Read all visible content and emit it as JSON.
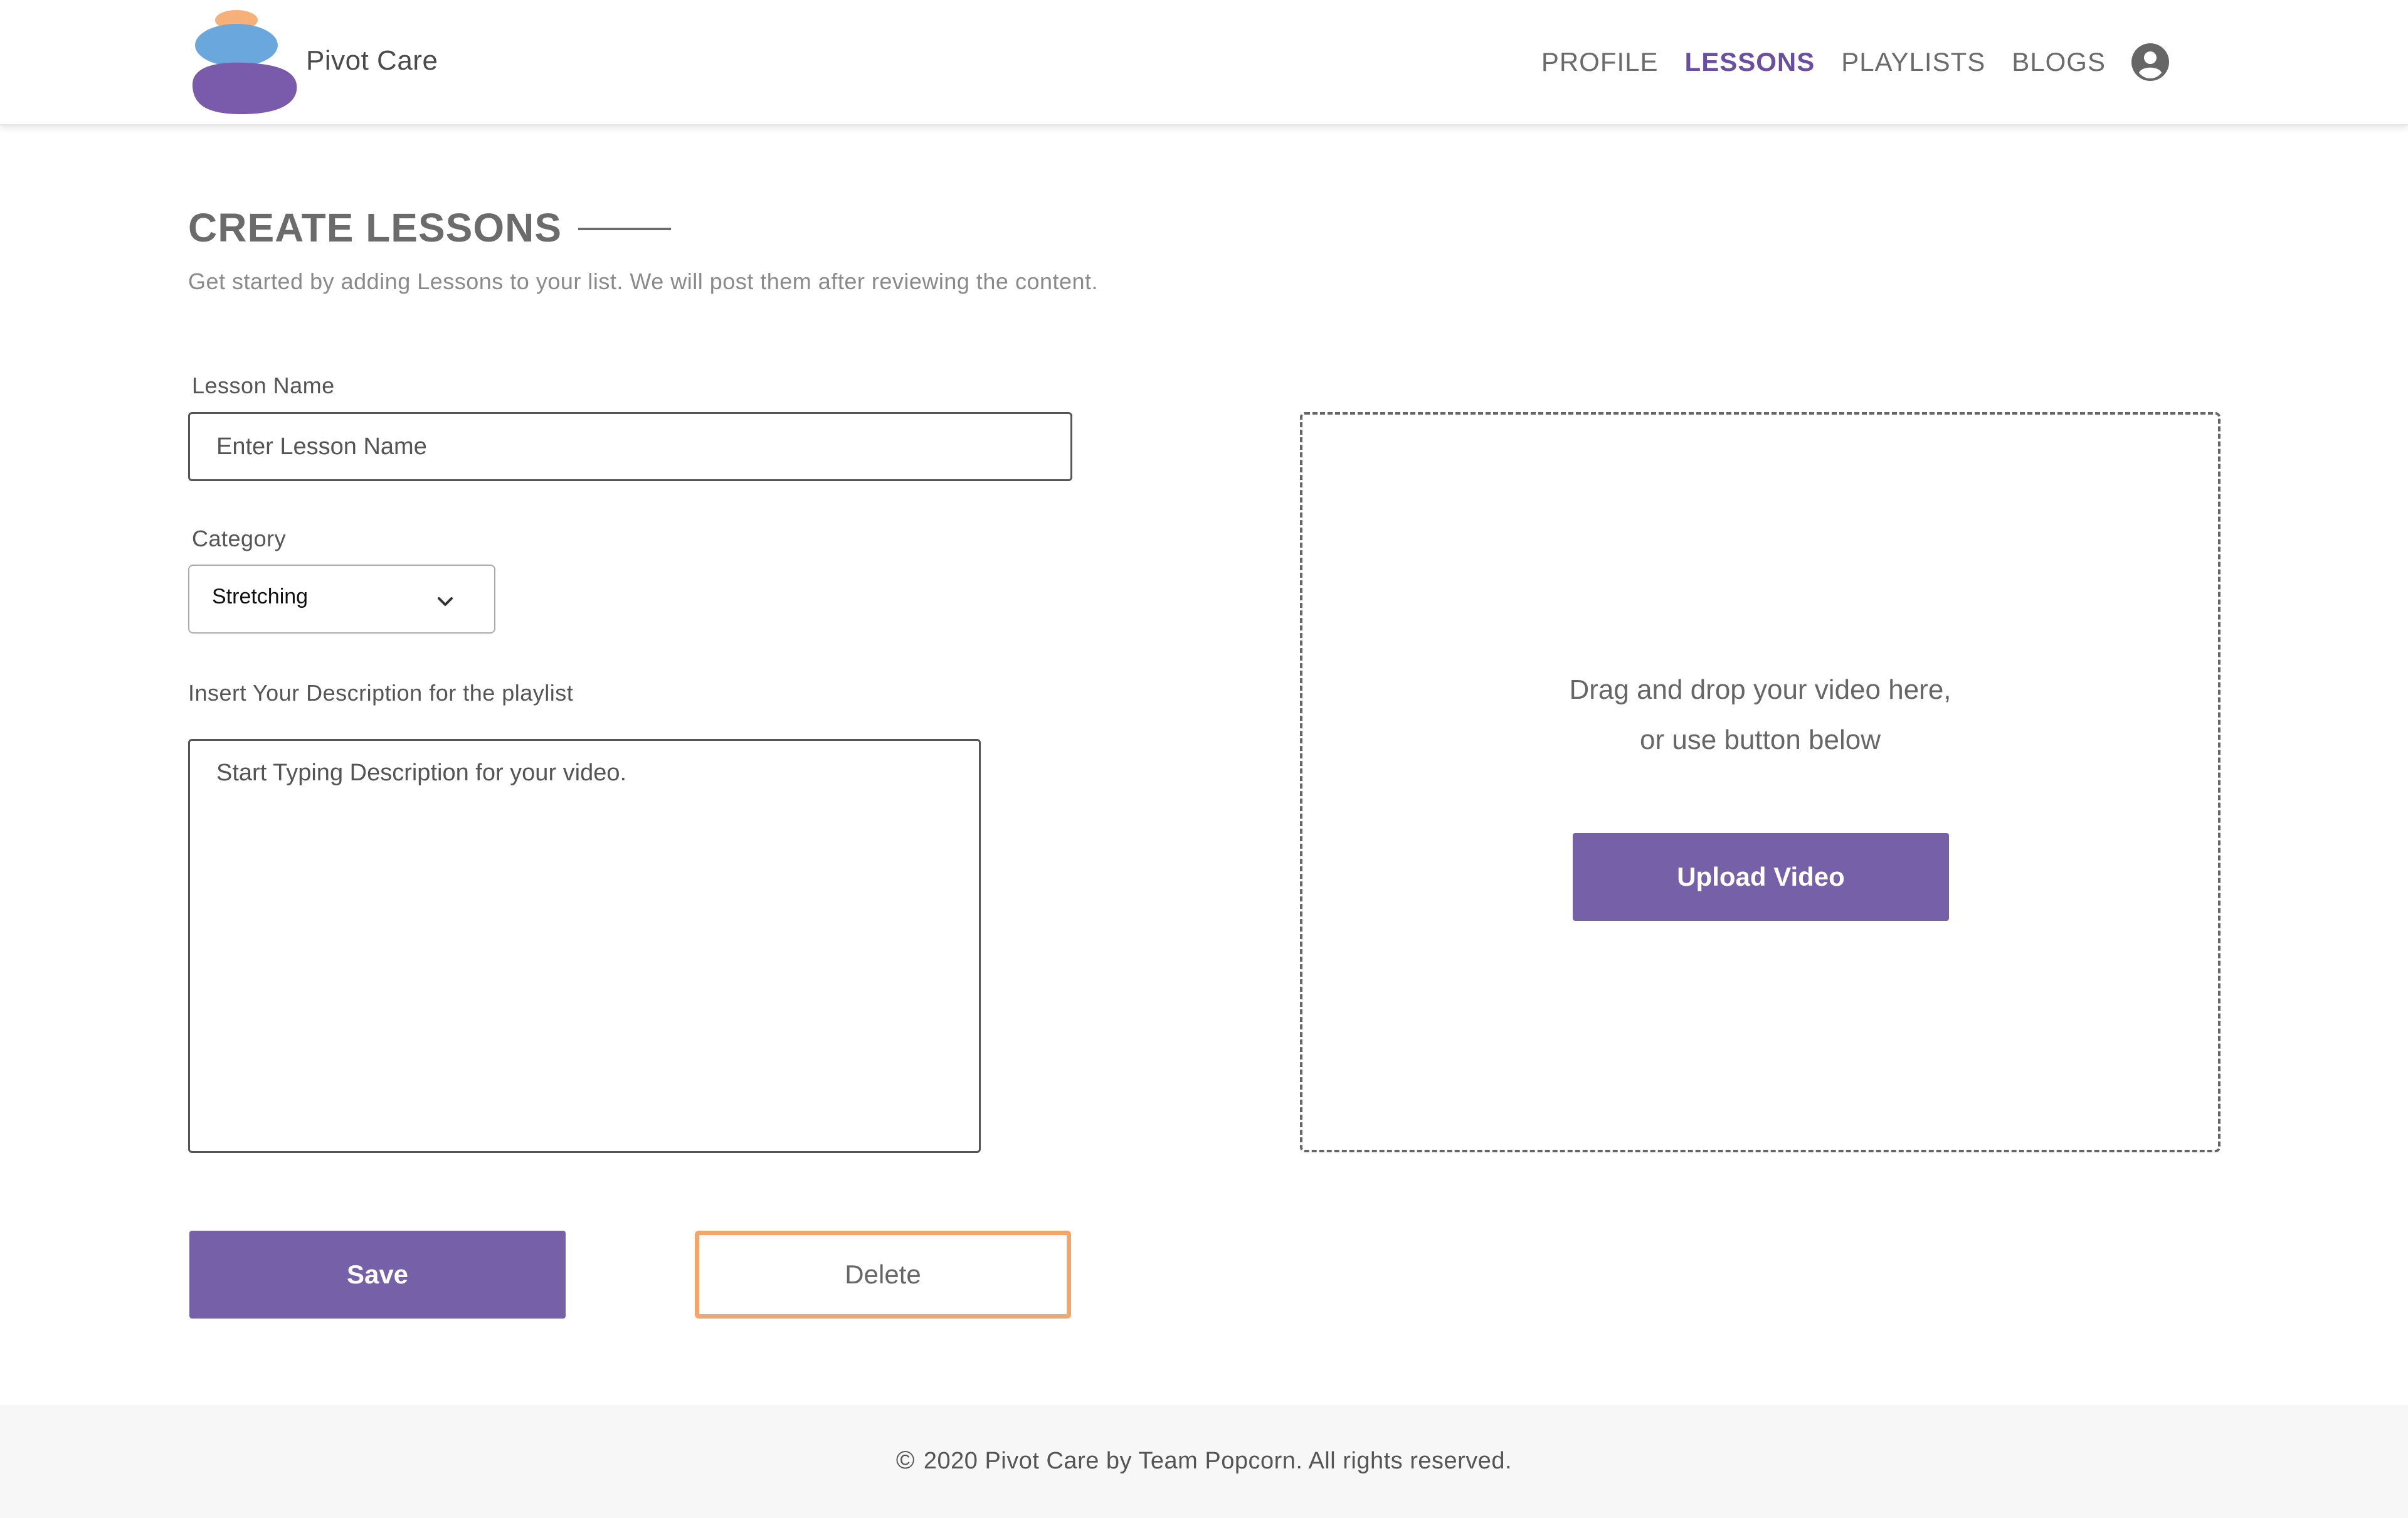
{
  "header": {
    "brand": "Pivot Care",
    "nav": [
      {
        "label": "PROFILE",
        "active": false
      },
      {
        "label": "LESSONS",
        "active": true
      },
      {
        "label": "PLAYLISTS",
        "active": false
      },
      {
        "label": "BLOGS",
        "active": false
      }
    ],
    "account_icon": "user-circle-icon",
    "logo_colors": [
      "#f6b07a",
      "#6aa7dc",
      "#7a5aaa"
    ]
  },
  "main": {
    "title": "CREATE LESSONS",
    "subtitle": "Get started by adding Lessons to your list. We will post them after reviewing the content.",
    "lesson_name": {
      "label": "Lesson Name",
      "placeholder": "Enter Lesson Name",
      "value": ""
    },
    "category": {
      "label": "Category",
      "selected": "Stretching"
    },
    "description": {
      "label": "Insert Your Description for the playlist",
      "placeholder": "Start Typing Description for your video.",
      "value": ""
    },
    "dropzone": {
      "line1": "Drag and drop your video here,",
      "line2": "or use button below",
      "upload_label": "Upload Video"
    },
    "save_label": "Save",
    "delete_label": "Delete"
  },
  "footer": {
    "copyright_symbol": "©",
    "text": "2020 Pivot Care by Team Popcorn. All rights reserved."
  },
  "colors": {
    "accent": "#7660a8",
    "active_nav": "#6a4fa0",
    "delete_border": "#f4a66a"
  }
}
